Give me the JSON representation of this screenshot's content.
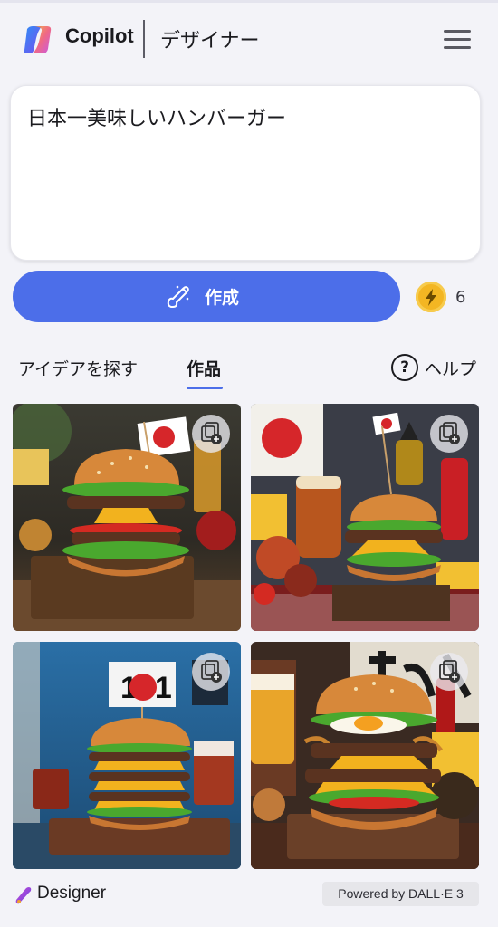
{
  "header": {
    "brand": "Copilot",
    "product": "デザイナー",
    "menu_icon": "hamburger-menu-icon"
  },
  "prompt": {
    "value": "日本一美味しいハンバーガー"
  },
  "create": {
    "label": "作成",
    "icon": "paint-brush-icon",
    "boost_icon": "lightning-bolt-icon",
    "boost_count": "6"
  },
  "tabs": [
    {
      "label": "アイデアを探す",
      "active": false
    },
    {
      "label": "作品",
      "active": true
    }
  ],
  "help": {
    "icon": "question-circle-icon",
    "label": "ヘルプ"
  },
  "images": [
    {
      "flag_text": "",
      "action_icon": "copy-add-icon"
    },
    {
      "flag_text": "",
      "action_icon": "copy-add-icon"
    },
    {
      "flag_text": "101",
      "action_icon": "copy-add-icon"
    },
    {
      "flag_text": "",
      "action_icon": "copy-add-icon"
    }
  ],
  "footer": {
    "designer_label": "Designer",
    "designer_icon": "designer-logo-icon",
    "powered_by": "Powered by DALL·E 3"
  },
  "colors": {
    "accent": "#4c6ee9",
    "background": "#f3f3f8",
    "boost": "#f3b623"
  }
}
